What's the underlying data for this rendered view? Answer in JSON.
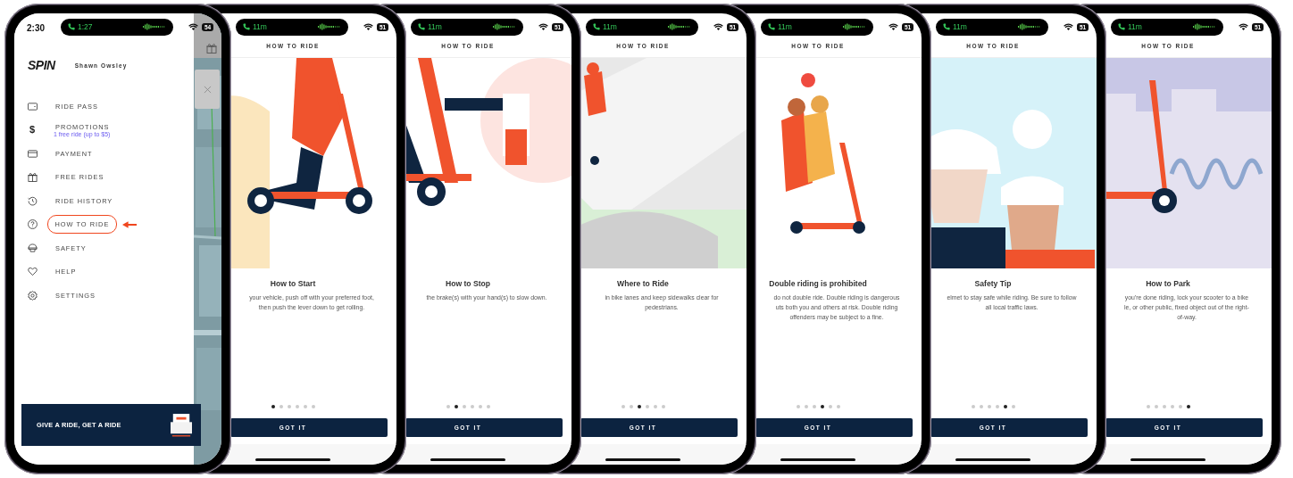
{
  "phones": [
    {
      "kind": "menu",
      "status": {
        "time": "2:30",
        "call": "1:27",
        "battery": "54"
      },
      "logo": "SPIN",
      "user": "Shawn Owsley",
      "menu": [
        {
          "label": "RIDE PASS",
          "selected": false
        },
        {
          "label": "PROMOTIONS",
          "glyph": "$",
          "note": "1 free ride (up to $5)",
          "selected": false
        },
        {
          "label": "PAYMENT",
          "selected": false
        },
        {
          "label": "FREE RIDES",
          "selected": false
        },
        {
          "label": "RIDE HISTORY",
          "selected": false
        },
        {
          "label": "HOW TO RIDE",
          "selected": true
        },
        {
          "label": "SAFETY",
          "selected": false
        },
        {
          "label": "HELP",
          "selected": false
        },
        {
          "label": "SETTINGS",
          "selected": false
        }
      ],
      "banner": "GIVE A RIDE, GET A RIDE"
    },
    {
      "kind": "slide",
      "status": {
        "call": "11m",
        "battery": "51"
      },
      "header": "HOW TO RIDE",
      "title": "How to Start",
      "body": [
        "your vehicle, push off with your preferred foot,",
        "then push the lever down to get rolling."
      ],
      "pages": [
        {
          "selected": true
        },
        {
          "selected": false
        },
        {
          "selected": false
        },
        {
          "selected": false
        },
        {
          "selected": false
        },
        {
          "selected": false
        }
      ],
      "button": "GOT IT"
    },
    {
      "kind": "slide",
      "status": {
        "call": "11m",
        "battery": "51"
      },
      "header": "HOW TO RIDE",
      "title": "How to Stop",
      "body": [
        "the brake(s) with your hand(s) to slow down."
      ],
      "pages": [
        {
          "selected": false
        },
        {
          "selected": true
        },
        {
          "selected": false
        },
        {
          "selected": false
        },
        {
          "selected": false
        },
        {
          "selected": false
        }
      ],
      "button": "GOT IT"
    },
    {
      "kind": "slide",
      "status": {
        "call": "11m",
        "battery": "51"
      },
      "header": "HOW TO RIDE",
      "title": "Where to Ride",
      "body": [
        "in bike lanes and keep sidewalks clear for",
        "pedestrians."
      ],
      "pages": [
        {
          "selected": false
        },
        {
          "selected": false
        },
        {
          "selected": true
        },
        {
          "selected": false
        },
        {
          "selected": false
        },
        {
          "selected": false
        }
      ],
      "button": "GOT IT"
    },
    {
      "kind": "slide",
      "status": {
        "call": "11m",
        "battery": "51"
      },
      "header": "HOW TO RIDE",
      "title": "Double riding is prohibited",
      "body": [
        "do not double ride. Double riding is dangerous",
        "uts both you and others at risk. Double riding",
        "offenders may be subject to a fine."
      ],
      "pages": [
        {
          "selected": false
        },
        {
          "selected": false
        },
        {
          "selected": false
        },
        {
          "selected": true
        },
        {
          "selected": false
        },
        {
          "selected": false
        }
      ],
      "button": "GOT IT"
    },
    {
      "kind": "slide",
      "status": {
        "call": "11m",
        "battery": "51"
      },
      "header": "HOW TO RIDE",
      "title": "Safety Tip",
      "body": [
        "elmet to stay safe while riding. Be sure to follow",
        "all local traffic laws."
      ],
      "pages": [
        {
          "selected": false
        },
        {
          "selected": false
        },
        {
          "selected": false
        },
        {
          "selected": false
        },
        {
          "selected": true
        },
        {
          "selected": false
        }
      ],
      "button": "GOT IT"
    },
    {
      "kind": "slide",
      "status": {
        "call": "11m",
        "battery": "51"
      },
      "header": "HOW TO RIDE",
      "title": "How to Park",
      "body": [
        "you're done riding, lock your scooter to a bike",
        "le, or other public, fixed object out of the right-",
        "of-way."
      ],
      "pages": [
        {
          "selected": false
        },
        {
          "selected": false
        },
        {
          "selected": false
        },
        {
          "selected": false
        },
        {
          "selected": false
        },
        {
          "selected": true
        }
      ],
      "button": "GOT IT"
    }
  ]
}
